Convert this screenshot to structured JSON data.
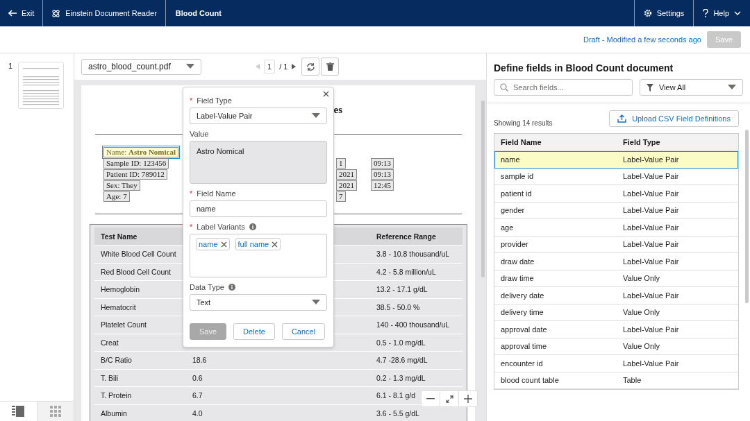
{
  "header": {
    "exit": "Exit",
    "app": "Einstein Document Reader",
    "title": "Blood Count",
    "settings": "Settings",
    "help": "Help"
  },
  "subheader": {
    "status": "Draft - Modified a few seconds ago",
    "save": {
      "label": "Save",
      "disabled": true
    }
  },
  "thumbnails": [
    {
      "page": "1"
    }
  ],
  "viewer": {
    "file": "astro_blood_count.pdf",
    "page": "1",
    "total": "/ 1",
    "document": {
      "title_fragment": "es",
      "fields": [
        {
          "label": "Name: **Astro Nomical**",
          "selected": true
        },
        {
          "label": "Sample ID: 123456",
          "selected": false,
          "date": "1",
          "time": "09:13"
        },
        {
          "label": "Patient ID: 789012",
          "selected": false,
          "date": "2021",
          "time": "09:13"
        },
        {
          "label": "Sex: They",
          "selected": false,
          "date": "2021",
          "time": "12:45"
        },
        {
          "label": "Age: 7",
          "selected": false,
          "date": "7"
        }
      ],
      "table": {
        "columns": [
          "Test Name",
          "Reference Range"
        ],
        "rows": [
          {
            "test_name": "White Blood Cell Count",
            "reference_range": "3.8 - 10.8 thousand/uL"
          },
          {
            "test_name": "Red Blood Cell Count",
            "reference_range": "4.2 - 5.8 million/uL"
          },
          {
            "test_name": "Hemoglobin",
            "reference_range": "13.2 - 17.1 g/dL"
          },
          {
            "test_name": "Hematocrit",
            "reference_range": "38.5 - 50.0 %"
          },
          {
            "test_name": "Platelet Count",
            "reference_range": "140 - 400 thousand/uL"
          },
          {
            "test_name": "Creat",
            "reference_range": "0.5 - 1.0 mg/dL"
          },
          {
            "test_name": "B/C Ratio",
            "result": "18.6",
            "reference_range": "4.7 -28.6 mg/dL"
          },
          {
            "test_name": "T. Bili",
            "result": "0.6",
            "reference_range": "0.2 - 1.3 mg/dL"
          },
          {
            "test_name": "T. Protein",
            "result": "6.7",
            "reference_range": "6.1 - 8.1 g/d"
          },
          {
            "test_name": "Albumin",
            "result": "4.0",
            "reference_range": "3.6 - 5.5 g/dL"
          }
        ]
      }
    }
  },
  "popover": {
    "field_type": {
      "label": "Field Type",
      "required_mark": "*",
      "value": "Label-Value Pair"
    },
    "value": {
      "label": "Value",
      "value": "Astro Nomical"
    },
    "field_name": {
      "label": "Field Name",
      "required_mark": "*",
      "value": "name"
    },
    "label_variants": {
      "label": "Label Variants",
      "required_mark": "*",
      "pills": [
        "name",
        "full name"
      ]
    },
    "data_type": {
      "label": "Data Type",
      "value": "Text"
    },
    "buttons": [
      {
        "label": "Save",
        "disabled": true
      },
      {
        "label": "Delete",
        "disabled": false
      },
      {
        "label": "Cancel",
        "disabled": false
      }
    ]
  },
  "panel": {
    "title": "Define fields in Blood Count document",
    "search": {
      "placeholder": "Search fields..."
    },
    "filter": "View All",
    "upload": "Upload CSV Field Definitions",
    "count": "Showing 14 results",
    "columns": [
      "Field Name",
      "Field Type"
    ],
    "rows": [
      {
        "name": "name",
        "type": "Label-Value Pair",
        "selected": true
      },
      {
        "name": "sample id",
        "type": "Label-Value Pair",
        "selected": false
      },
      {
        "name": "patient id",
        "type": "Label-Value Pair",
        "selected": false
      },
      {
        "name": "gender",
        "type": "Label-Value Pair",
        "selected": false
      },
      {
        "name": "age",
        "type": "Label-Value Pair",
        "selected": false
      },
      {
        "name": "provider",
        "type": "Label-Value Pair",
        "selected": false
      },
      {
        "name": "draw date",
        "type": "Label-Value Pair",
        "selected": false
      },
      {
        "name": "draw time",
        "type": "Value Only",
        "selected": false
      },
      {
        "name": "delivery date",
        "type": "Label-Value Pair",
        "selected": false
      },
      {
        "name": "delivery time",
        "type": "Value Only",
        "selected": false
      },
      {
        "name": "approval date",
        "type": "Label-Value Pair",
        "selected": false
      },
      {
        "name": "approval time",
        "type": "Value Only",
        "selected": false
      },
      {
        "name": "encounter id",
        "type": "Label-Value Pair",
        "selected": false
      },
      {
        "name": "blood count table",
        "type": "Table",
        "selected": false
      }
    ]
  }
}
